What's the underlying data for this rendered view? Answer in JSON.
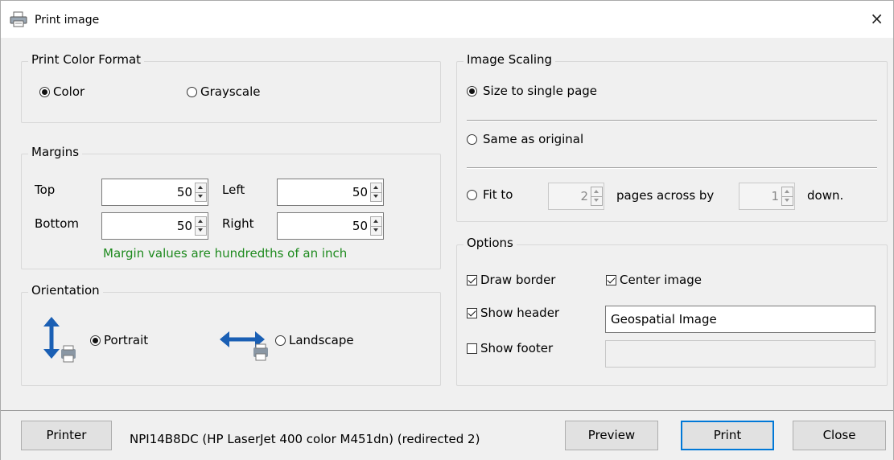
{
  "window": {
    "title": "Print image",
    "close_glyph": "×"
  },
  "color_format": {
    "legend": "Print Color Format",
    "options": [
      {
        "label": "Color",
        "selected": true
      },
      {
        "label": "Grayscale",
        "selected": false
      }
    ]
  },
  "margins": {
    "legend": "Margins",
    "top": {
      "label": "Top",
      "value": "50"
    },
    "left": {
      "label": "Left",
      "value": "50"
    },
    "bottom": {
      "label": "Bottom",
      "value": "50"
    },
    "right": {
      "label": "Right",
      "value": "50"
    },
    "hint": "Margin values are hundredths of an inch",
    "hint_color": "#1e8a1e"
  },
  "orientation": {
    "legend": "Orientation",
    "portrait": {
      "label": "Portrait",
      "selected": true,
      "icon": "portrait-orientation-icon"
    },
    "landscape": {
      "label": "Landscape",
      "selected": false,
      "icon": "landscape-orientation-icon"
    }
  },
  "scaling": {
    "legend": "Image Scaling",
    "single_page": {
      "label": "Size to single page",
      "selected": true
    },
    "same_original": {
      "label": "Same as original",
      "selected": false
    },
    "fit_to": {
      "label": "Fit to",
      "selected": false,
      "across_value": "2",
      "across_label": "pages across by",
      "down_value": "1",
      "down_label": "down."
    }
  },
  "options": {
    "legend": "Options",
    "draw_border": {
      "label": "Draw border",
      "checked": true
    },
    "center_image": {
      "label": "Center image",
      "checked": true
    },
    "show_header": {
      "label": "Show header",
      "checked": true,
      "text": "Geospatial Image"
    },
    "show_footer": {
      "label": "Show footer",
      "checked": false,
      "text": ""
    }
  },
  "footer": {
    "printer_button": "Printer",
    "printer_name": "NPI14B8DC (HP LaserJet 400 color M451dn) (redirected 2)",
    "preview_button": "Preview",
    "print_button": "Print",
    "close_button": "Close",
    "accent": "#0078d7"
  }
}
